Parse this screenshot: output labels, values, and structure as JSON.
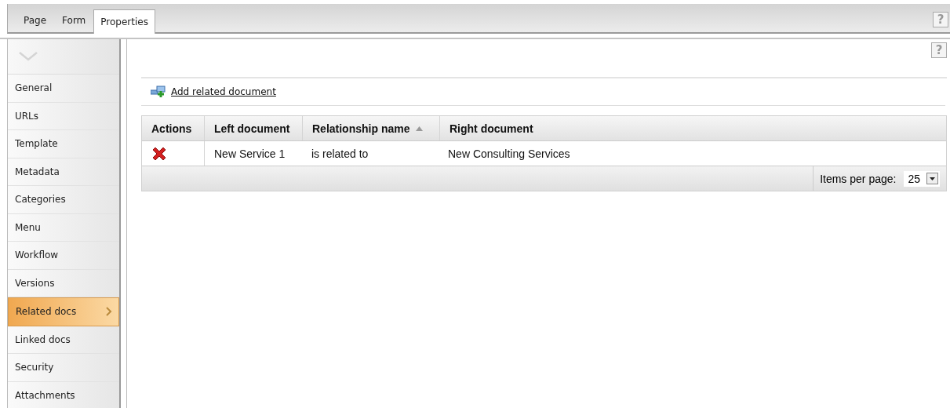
{
  "tabs": [
    {
      "label": "Page",
      "selected": false
    },
    {
      "label": "Form",
      "selected": false
    },
    {
      "label": "Properties",
      "selected": true
    }
  ],
  "top_help": "?",
  "sidebar": {
    "items": [
      {
        "label": "General",
        "selected": false
      },
      {
        "label": "URLs",
        "selected": false
      },
      {
        "label": "Template",
        "selected": false
      },
      {
        "label": "Metadata",
        "selected": false
      },
      {
        "label": "Categories",
        "selected": false
      },
      {
        "label": "Menu",
        "selected": false
      },
      {
        "label": "Workflow",
        "selected": false
      },
      {
        "label": "Versions",
        "selected": false
      },
      {
        "label": "Related docs",
        "selected": true
      },
      {
        "label": "Linked docs",
        "selected": false
      },
      {
        "label": "Security",
        "selected": false
      },
      {
        "label": "Attachments",
        "selected": false
      }
    ]
  },
  "panel_help": "?",
  "add_link": "Add related document",
  "table": {
    "columns": [
      {
        "label": "Actions",
        "sorted": false
      },
      {
        "label": "Left document",
        "sorted": false
      },
      {
        "label": "Relationship name",
        "sorted": true
      },
      {
        "label": "Right document",
        "sorted": false
      }
    ],
    "rows": [
      {
        "left": "New Service 1",
        "relationship": "is related to",
        "right": "New Consulting Services"
      }
    ]
  },
  "pager": {
    "label": "Items per page:",
    "value": "25"
  }
}
